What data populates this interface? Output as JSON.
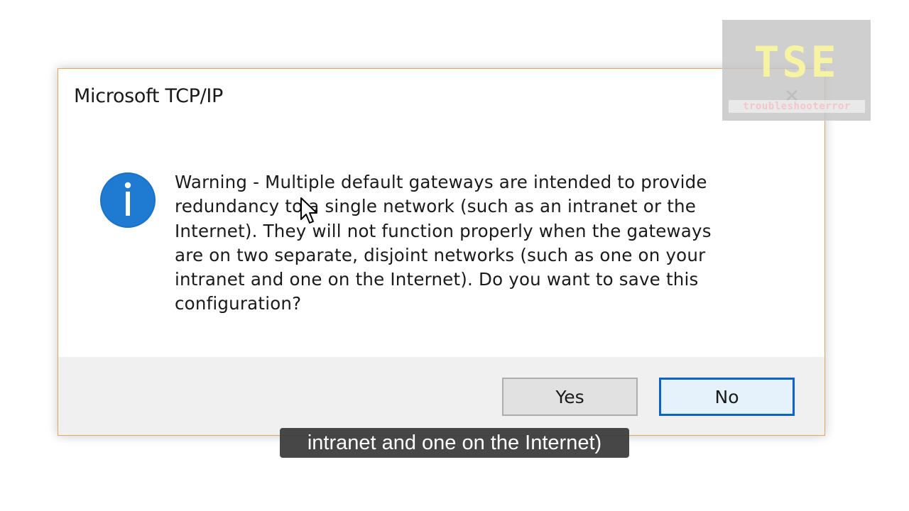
{
  "dialog": {
    "title": "Microsoft TCP/IP",
    "close_glyph": "✕",
    "icon": "info-icon",
    "message": "Warning - Multiple default gateways are intended to provide\nredundancy to a single network (such as an intranet or the\nInternet). They will not function properly when the gateways\nare on two separate, disjoint networks (such as one on your\nintranet and one on the Internet). Do you want to save this\nconfiguration?",
    "buttons": {
      "yes": "Yes",
      "no": "No"
    },
    "focused_button": "no"
  },
  "watermark": {
    "logo": "TSE",
    "site": "troubleshooterror"
  },
  "caption": {
    "text": "intranet and one on the Internet)"
  },
  "colors": {
    "info_icon_blue": "#1a73c9",
    "focus_border": "#0a64c8",
    "dialog_border": "#e2a862"
  }
}
